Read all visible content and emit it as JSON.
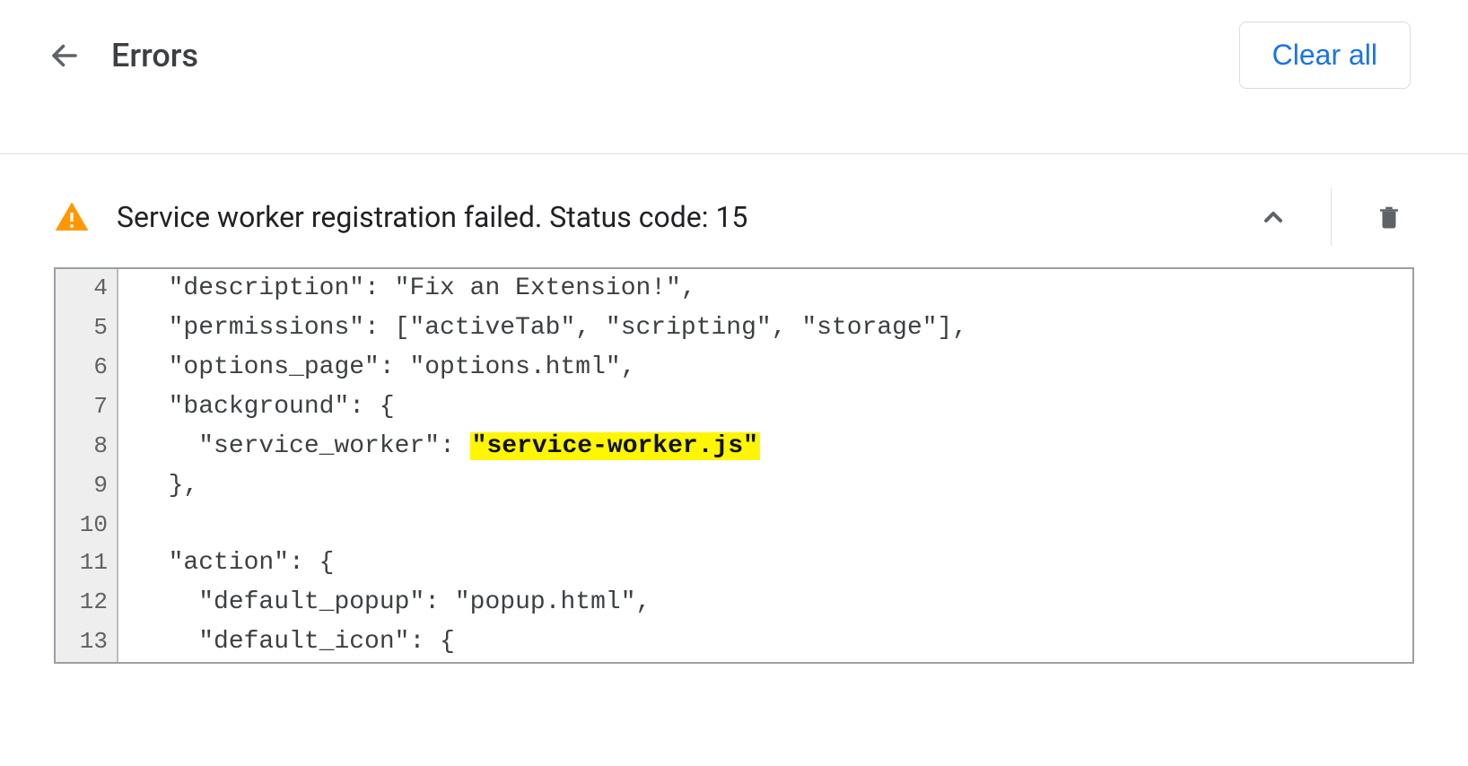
{
  "header": {
    "title": "Errors",
    "clear_all_label": "Clear all"
  },
  "error": {
    "title": "Service worker registration failed. Status code: 15",
    "code_lines": [
      {
        "num": "4",
        "indent": "  ",
        "segments": [
          {
            "t": "\"description\": \"Fix an Extension!\","
          }
        ]
      },
      {
        "num": "5",
        "indent": "  ",
        "segments": [
          {
            "t": "\"permissions\": [\"activeTab\", \"scripting\", \"storage\"],"
          }
        ]
      },
      {
        "num": "6",
        "indent": "  ",
        "segments": [
          {
            "t": "\"options_page\": \"options.html\","
          }
        ]
      },
      {
        "num": "7",
        "indent": "  ",
        "segments": [
          {
            "t": "\"background\": {"
          }
        ]
      },
      {
        "num": "8",
        "indent": "    ",
        "segments": [
          {
            "t": "\"service_worker\": "
          },
          {
            "t": "\"service-worker.js\"",
            "hl": true
          }
        ]
      },
      {
        "num": "9",
        "indent": "  ",
        "segments": [
          {
            "t": "},"
          }
        ]
      },
      {
        "num": "10",
        "indent": "",
        "segments": [
          {
            "t": ""
          }
        ]
      },
      {
        "num": "11",
        "indent": "  ",
        "segments": [
          {
            "t": "\"action\": {"
          }
        ]
      },
      {
        "num": "12",
        "indent": "    ",
        "segments": [
          {
            "t": "\"default_popup\": \"popup.html\","
          }
        ]
      },
      {
        "num": "13",
        "indent": "    ",
        "segments": [
          {
            "t": "\"default_icon\": {"
          }
        ]
      }
    ]
  }
}
